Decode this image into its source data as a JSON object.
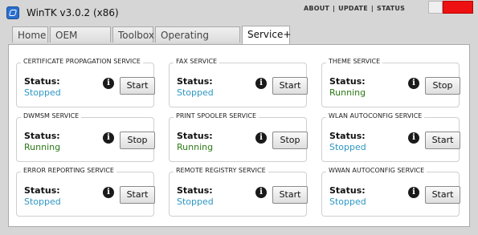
{
  "window": {
    "title": "WinTK v3.0.2 (x86)",
    "links": [
      "ABOUT",
      "UPDATE",
      "STATUS"
    ]
  },
  "tabs": [
    "Home",
    "OEM Editor",
    "Toolbox",
    "Operating System",
    "Service+"
  ],
  "active_tab": "Service+",
  "status_label": "Status:",
  "services": [
    {
      "name": "CERTIFICATE PROPAGATION SERVICE",
      "status": "Stopped",
      "action": "Start"
    },
    {
      "name": "FAX SERVICE",
      "status": "Stopped",
      "action": "Start"
    },
    {
      "name": "THEME SERVICE",
      "status": "Running",
      "action": "Stop"
    },
    {
      "name": "DWMSM SERVICE",
      "status": "Running",
      "action": "Stop"
    },
    {
      "name": "PRINT SPOOLER SERVICE",
      "status": "Running",
      "action": "Stop"
    },
    {
      "name": "WLAN AUTOCONFIG SERVICE",
      "status": "Stopped",
      "action": "Start"
    },
    {
      "name": "ERROR REPORTING SERVICE",
      "status": "Stopped",
      "action": "Start"
    },
    {
      "name": "REMOTE REGISTRY SERVICE",
      "status": "Stopped",
      "action": "Start"
    },
    {
      "name": "WWAN AUTOCONFIG SERVICE",
      "status": "Stopped",
      "action": "Start"
    }
  ],
  "colors": {
    "stopped": "#2d97c3",
    "running": "#2a7a14",
    "close_button": "#ee1111"
  },
  "icons": {
    "info": "info-icon",
    "app": "app-icon"
  }
}
